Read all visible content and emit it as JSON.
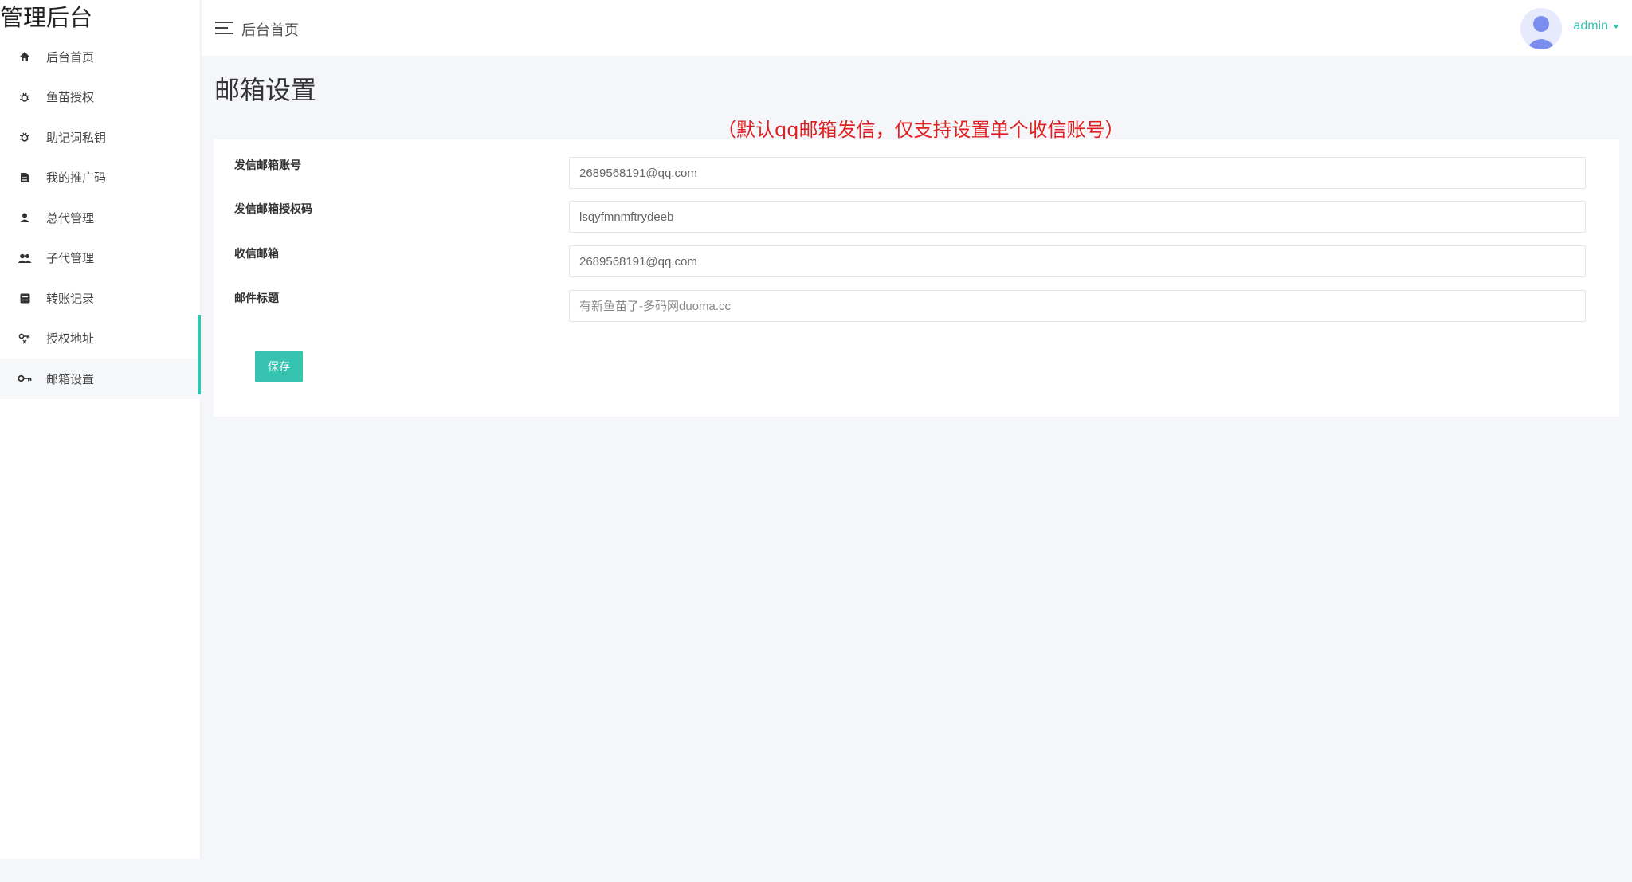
{
  "brand": "管理后台",
  "sidebar": {
    "items": [
      {
        "label": "后台首页",
        "icon": "home-icon"
      },
      {
        "label": "鱼苗授权",
        "icon": "bug-icon"
      },
      {
        "label": "助记词私钥",
        "icon": "bug-icon"
      },
      {
        "label": "我的推广码",
        "icon": "document-icon"
      },
      {
        "label": "总代管理",
        "icon": "user-icon"
      },
      {
        "label": "子代管理",
        "icon": "users-icon"
      },
      {
        "label": "转账记录",
        "icon": "list-icon"
      },
      {
        "label": "授权地址",
        "icon": "key-address-icon"
      },
      {
        "label": "邮箱设置",
        "icon": "key-icon"
      }
    ],
    "active_index": 8
  },
  "topbar": {
    "breadcrumb": "后台首页",
    "user_name": "admin"
  },
  "page": {
    "title": "邮箱设置",
    "notice": "（默认qq邮箱发信，仅支持设置单个收信账号）"
  },
  "form": {
    "fields": [
      {
        "label": "发信邮箱账号",
        "value": "2689568191@qq.com"
      },
      {
        "label": "发信邮箱授权码",
        "value": "lsqyfmnmftrydeeb"
      },
      {
        "label": "收信邮箱",
        "value": "2689568191@qq.com"
      },
      {
        "label": "邮件标题",
        "value": "有新鱼苗了-多码网duoma.cc"
      }
    ],
    "save_label": "保存"
  },
  "colors": {
    "accent": "#36c3b0",
    "notice": "#e02020",
    "background": "#f4f6fa"
  }
}
